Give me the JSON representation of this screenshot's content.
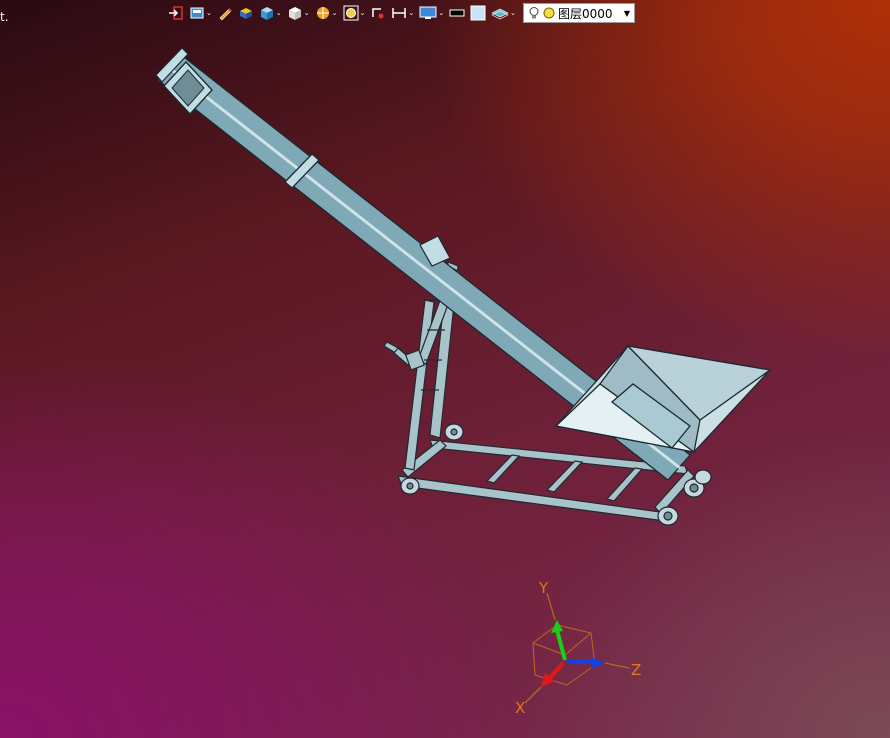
{
  "toolbar": {
    "layer_value": "图层0000",
    "items": [
      {
        "icon": "exit-icon"
      },
      {
        "icon": "save-dropdown-icon"
      },
      {
        "icon": "pencil-icon"
      },
      {
        "icon": "box-icon"
      },
      {
        "icon": "cube-icon"
      },
      {
        "icon": "view-cube-icon"
      },
      {
        "icon": "render-icon"
      },
      {
        "icon": "zoom-icon"
      },
      {
        "icon": "snap-icon"
      },
      {
        "icon": "measure-icon"
      },
      {
        "icon": "display-icon"
      },
      {
        "icon": "color-icon"
      },
      {
        "icon": "background-icon"
      },
      {
        "icon": "layer-stack-icon"
      }
    ]
  },
  "viewport": {
    "stray_char": "t.",
    "model": "screw-conveyor-auger",
    "triad": {
      "x_label": "X",
      "y_label": "Y",
      "z_label": "Z"
    }
  },
  "colors": {
    "tube": "#a9c9d3",
    "outline": "#1a2a30",
    "axis_x": "#e01818",
    "axis_y": "#18d018",
    "axis_z": "#1840e0",
    "triad_label": "#e07a1a"
  }
}
